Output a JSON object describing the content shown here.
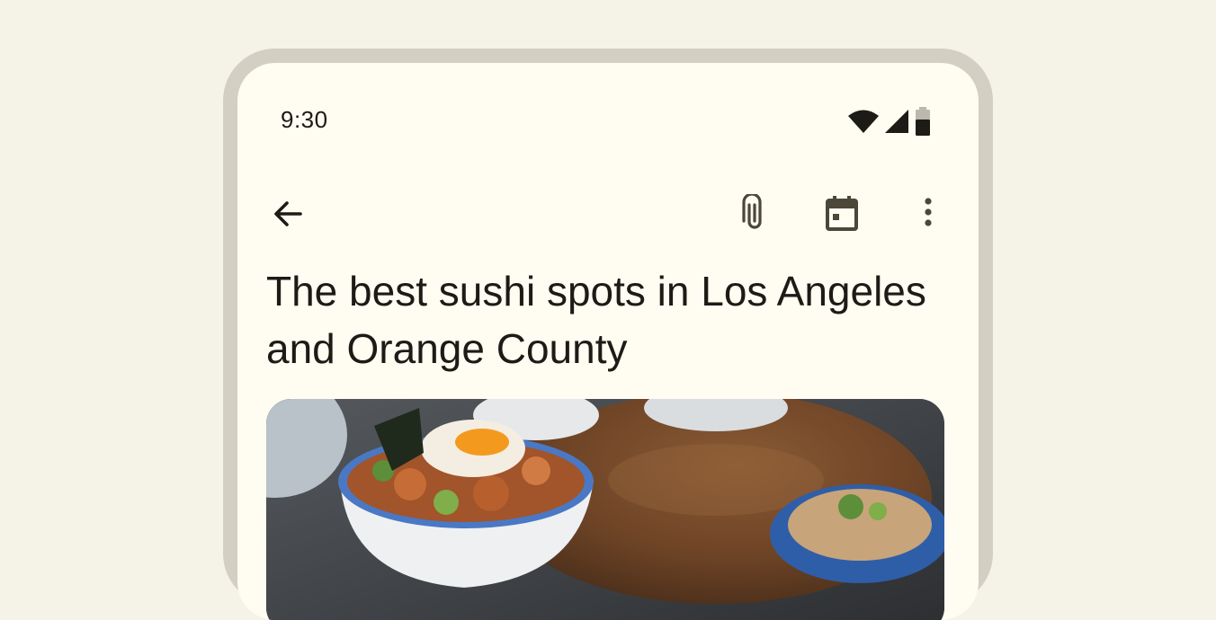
{
  "status_bar": {
    "time": "9:30",
    "icons": [
      "wifi-icon",
      "cellular-signal-icon",
      "battery-icon"
    ]
  },
  "top_app_bar": {
    "navigation_icon": "arrow-back-icon",
    "actions": [
      "attach-file-icon",
      "calendar-icon",
      "more-vert-icon"
    ]
  },
  "article": {
    "title": "The best sushi spots in Los Angeles and Orange County",
    "hero_image": "food-bowl-photo"
  },
  "colors": {
    "background": "#f5f2e7",
    "frame": "#d3cfc2",
    "surface": "#fffcf2",
    "on_surface": "#1d1b16",
    "icon_muted": "#4b4739"
  }
}
